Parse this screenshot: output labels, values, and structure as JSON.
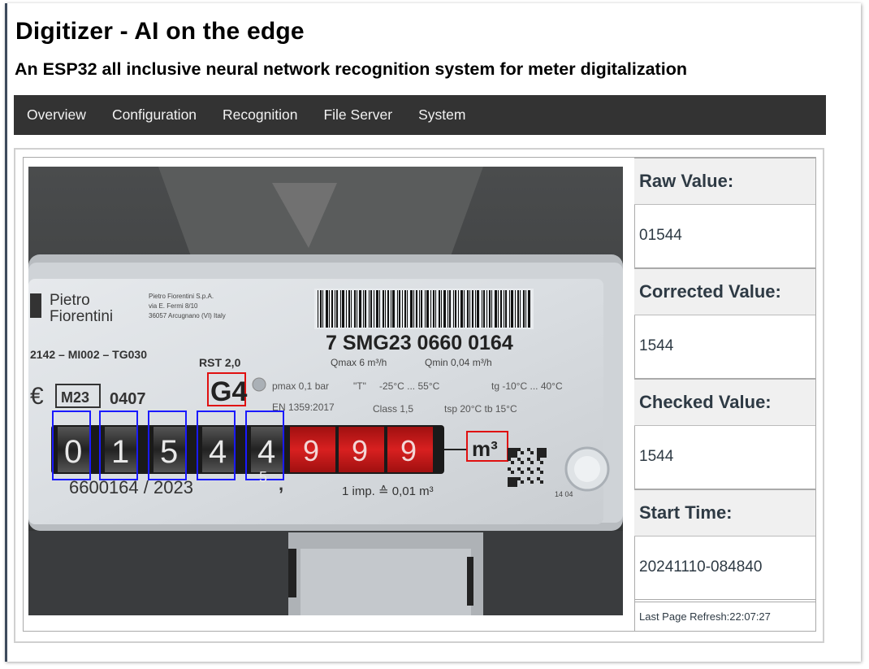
{
  "header": {
    "title": "Digitizer - AI on the edge",
    "subtitle": "An ESP32 all inclusive neural network recognition system for meter digitalization"
  },
  "nav": [
    {
      "label": "Overview"
    },
    {
      "label": "Configuration"
    },
    {
      "label": "Recognition"
    },
    {
      "label": "File Server"
    },
    {
      "label": "System"
    }
  ],
  "status": {
    "raw_label": "Raw Value:",
    "raw_value": "01544",
    "corrected_label": "Corrected Value:",
    "corrected_value": "1544",
    "checked_label": "Checked Value:",
    "checked_value": "1544",
    "start_label": "Start Time:",
    "start_value": "20241110-084840",
    "refresh_text": "Last Page Refresh:22:07:27"
  },
  "meter": {
    "brand_line1": "Pietro",
    "brand_line2": "Fiorentini",
    "brand_address1": "Pietro Fiorentini S.p.A.",
    "brand_address2": "via E. Fermi 8/10",
    "brand_address3": "36057 Arcugnano (VI) Italy",
    "serial": "7 SMG23 0660 0164",
    "qmax": "Qmax 6 m³/h",
    "qmin": "Qmin 0,04 m³/h",
    "code": "2142 – MI002 – TG030",
    "rst": "RST 2,0",
    "size": "G4",
    "ce_mark": "€",
    "m_mark": "M23",
    "cert": "0407",
    "pressure": "pmax 0,1 bar",
    "temp_t": "\"T\"",
    "temp_range": "-25°C ... 55°C",
    "tg": "tg -10°C ... 40°C",
    "en": "EN 1359:2017",
    "class": "Class 1,5",
    "tsp": "tsp 20°C  tb 15°C",
    "digits": [
      "0",
      "1",
      "5",
      "4",
      "4"
    ],
    "digit_next": "5",
    "red_digits": [
      "9",
      "9",
      "9"
    ],
    "unit": "m³",
    "bottom_serial": "6600164 / 2023",
    "impulse": "1 imp. ≙ 0,01 m³",
    "code_small": "14 04"
  },
  "colors": {
    "nav_bg": "#333333",
    "roi_digit": "#1a1aff",
    "roi_analog": "#e01010",
    "red_drum": "#c81818"
  }
}
